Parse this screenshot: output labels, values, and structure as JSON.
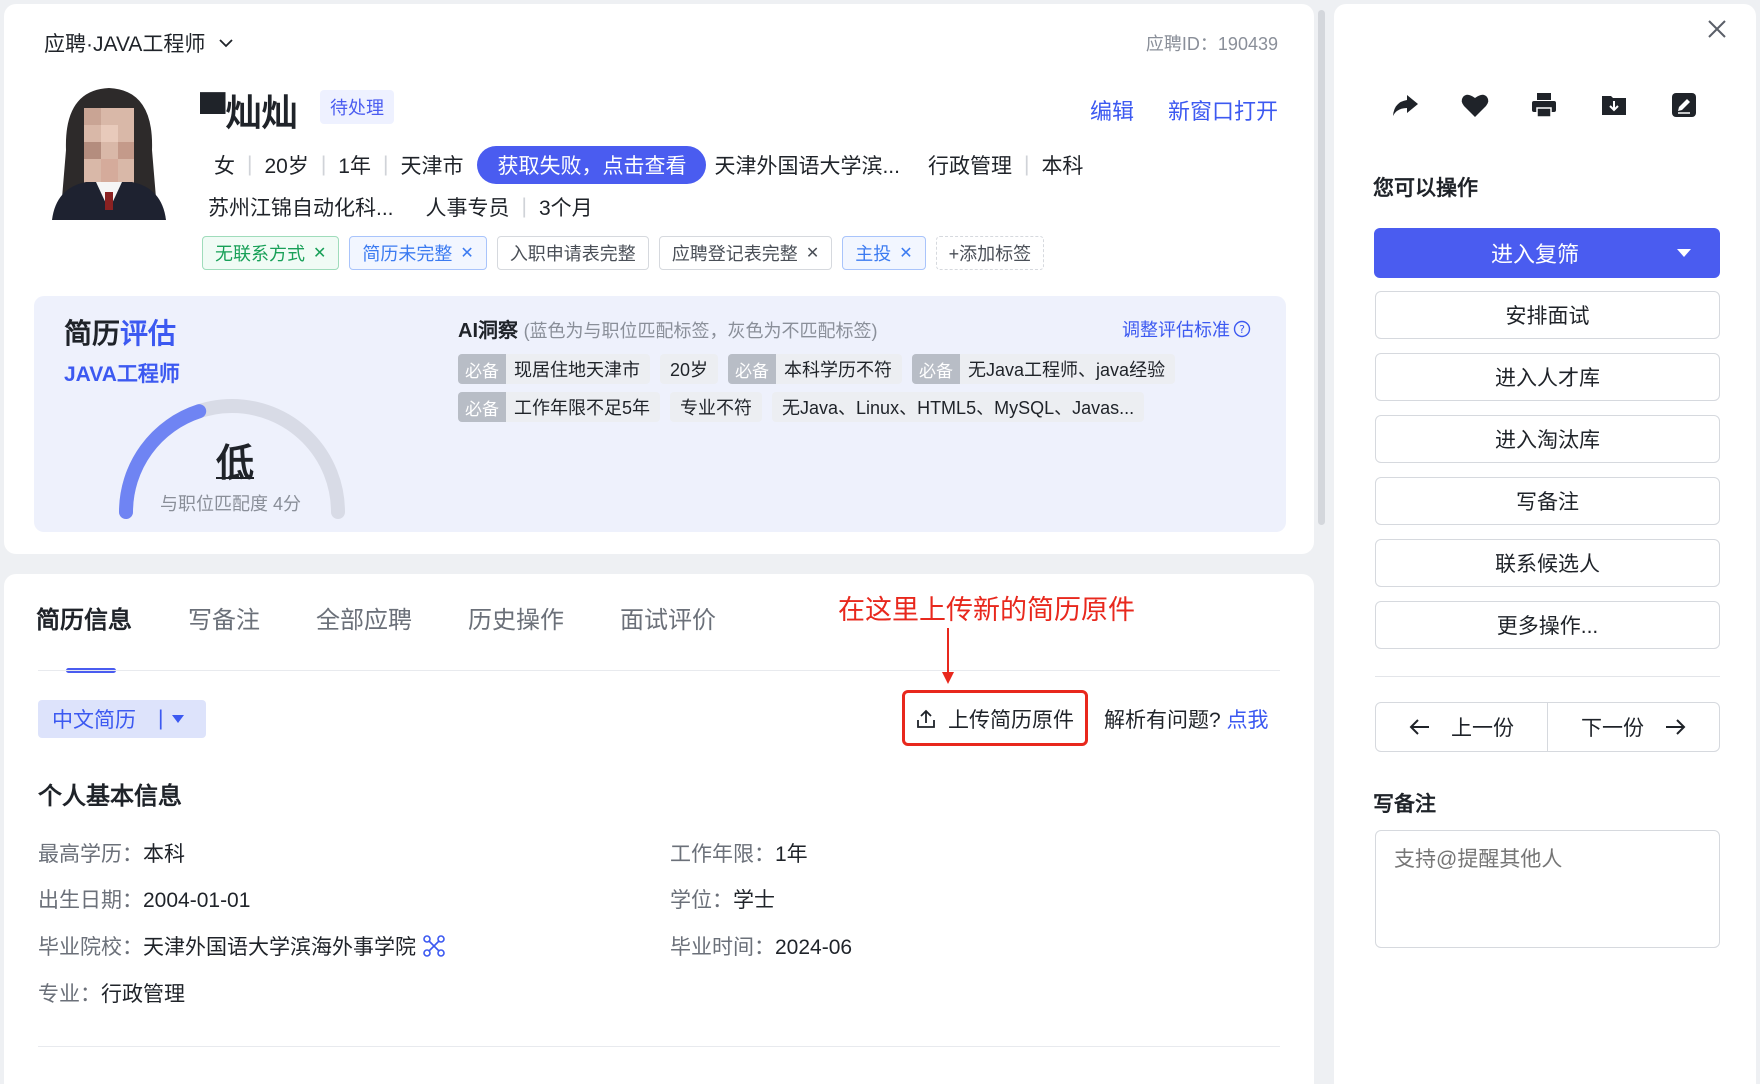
{
  "header": {
    "job_title": "应聘·JAVA工程师",
    "application_id_label": "应聘ID：",
    "application_id": "190439"
  },
  "candidate": {
    "name": "▀灿灿",
    "status": "待处理",
    "edit_label": "编辑",
    "open_new_window_label": "新窗口打开",
    "gender": "女",
    "age": "20岁",
    "experience": "1年",
    "city": "天津市",
    "fetch_failed_label": "获取失败，点击查看",
    "school": "天津外国语大学滨...",
    "major": "行政管理",
    "degree": "本科",
    "company": "苏州江锦自动化科...",
    "position": "人事专员",
    "duration": "3个月"
  },
  "tags": [
    {
      "label": "无联系方式",
      "closable": true,
      "style": "green"
    },
    {
      "label": "简历未完整",
      "closable": true,
      "style": "blue"
    },
    {
      "label": "入职申请表完整",
      "closable": false,
      "style": "default"
    },
    {
      "label": "应聘登记表完整",
      "closable": true,
      "style": "default"
    },
    {
      "label": "主投",
      "closable": true,
      "style": "blue"
    }
  ],
  "add_tag_label": "+添加标签",
  "evaluation": {
    "title_part1": "简历",
    "title_part2": "评估",
    "job": "JAVA工程师",
    "level": "低",
    "match_label": "与职位匹配度 4分",
    "match_score": 4,
    "match_max": 10,
    "ai_title": "AI洞察",
    "ai_note": "(蓝色为与职位匹配标签，灰色为不匹配标签)",
    "adjust_label": "调整评估标准",
    "must_label": "必备",
    "chips_row1": [
      {
        "label": "现居住地天津市",
        "must": true
      },
      {
        "label": "20岁",
        "must": false
      },
      {
        "label": "本科学历不符",
        "must": true
      },
      {
        "label": "无Java工程师、java经验",
        "must": true
      }
    ],
    "chips_row2": [
      {
        "label": "工作年限不足5年",
        "must": true
      },
      {
        "label": "专业不符",
        "must": false
      },
      {
        "label": "无Java、Linux、HTML5、MySQL、Javas...",
        "must": false
      }
    ]
  },
  "annotation": {
    "text": "在这里上传新的简历原件",
    "color": "#e8281d"
  },
  "tabs": [
    "简历信息",
    "写备注",
    "全部应聘",
    "历史操作",
    "面试评价"
  ],
  "resume": {
    "language_select": "中文简历",
    "upload_label": "上传简历原件",
    "parse_question": "解析有问题?",
    "click_me": "点我",
    "section_title": "个人基本信息",
    "fields_left": [
      {
        "label": "最高学历：",
        "value": "本科"
      },
      {
        "label": "出生日期：",
        "value": "2004-01-01"
      },
      {
        "label": "毕业院校：",
        "value": "天津外国语大学滨海外事学院"
      },
      {
        "label": "专业：",
        "value": "行政管理"
      }
    ],
    "fields_right": [
      {
        "label": "工作年限：",
        "value": "1年"
      },
      {
        "label": "学位：",
        "value": "学士"
      },
      {
        "label": "毕业时间：",
        "value": "2024-06"
      }
    ]
  },
  "sidebar": {
    "close_icon": "close-icon",
    "icons": [
      "share-icon",
      "heart-icon",
      "print-icon",
      "download-icon",
      "edit-icon"
    ],
    "section_title": "您可以操作",
    "primary_action": "进入复筛",
    "actions": [
      "安排面试",
      "进入人才库",
      "进入淘汰库",
      "写备注",
      "联系候选人",
      "更多操作..."
    ],
    "prev_label": "上一份",
    "next_label": "下一份",
    "note_title": "写备注",
    "note_placeholder": "支持@提醒其他人"
  },
  "colors": {
    "primary": "#4a5cf0",
    "accent_blue": "#3c59f1",
    "annotation_red": "#e8281d"
  }
}
